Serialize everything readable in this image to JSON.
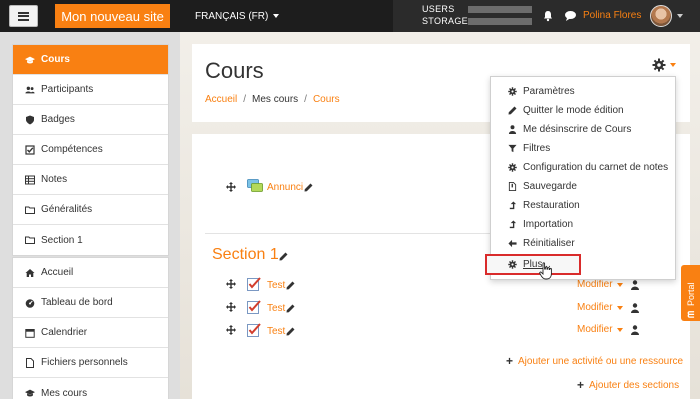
{
  "topbar": {
    "site_name": "Mon nouveau site",
    "language": "FRANÇAIS (FR)",
    "usage": {
      "users_label": "USERS",
      "storage_label": "STORAGE"
    },
    "user_name": "Polina Flores",
    "colors": {
      "bar": "#1d1d1d",
      "accent": "#f98012"
    }
  },
  "sidebar": {
    "course_items": [
      {
        "label": "Cours",
        "icon": "graduation-cap-icon",
        "active": true
      },
      {
        "label": "Participants",
        "icon": "users-icon"
      },
      {
        "label": "Badges",
        "icon": "shield-icon"
      },
      {
        "label": "Compétences",
        "icon": "checkbox-icon"
      },
      {
        "label": "Notes",
        "icon": "table-icon"
      },
      {
        "label": "Généralités",
        "icon": "folder-icon"
      },
      {
        "label": "Section 1",
        "icon": "folder-icon"
      }
    ],
    "site_items": [
      {
        "label": "Accueil",
        "icon": "home-icon"
      },
      {
        "label": "Tableau de bord",
        "icon": "dashboard-icon"
      },
      {
        "label": "Calendrier",
        "icon": "calendar-icon"
      },
      {
        "label": "Fichiers personnels",
        "icon": "file-icon"
      },
      {
        "label": "Mes cours",
        "icon": "graduation-cap-icon"
      }
    ]
  },
  "header": {
    "title": "Cours",
    "breadcrumb": [
      "Accueil",
      "/",
      "Mes cours",
      "/",
      "Cours"
    ]
  },
  "content": {
    "general_activity": "Annunci",
    "section_title": "Section 1",
    "quizzes": [
      {
        "label": "Test",
        "action": "Modifier"
      },
      {
        "label": "Test",
        "action": "Modifier"
      },
      {
        "label": "Test",
        "action": "Modifier"
      }
    ],
    "add_activity": "Ajouter une activité ou une ressource",
    "add_sections": "Ajouter des sections"
  },
  "dropdown": {
    "items": [
      {
        "label": "Paramètres",
        "icon": "gear-icon"
      },
      {
        "label": "Quitter le mode édition",
        "icon": "pencil-icon"
      },
      {
        "label": "Me désinscrire de Cours",
        "icon": "user-icon"
      },
      {
        "label": "Filtres",
        "icon": "filter-icon"
      },
      {
        "label": "Configuration du carnet de notes",
        "icon": "gear-icon"
      },
      {
        "label": "Sauvegarde",
        "icon": "file-archive-icon"
      },
      {
        "label": "Restauration",
        "icon": "level-up-icon"
      },
      {
        "label": "Importation",
        "icon": "level-up-icon"
      },
      {
        "label": "Réinitialiser",
        "icon": "arrow-left-icon"
      },
      {
        "label": "Plus...",
        "icon": "gear-icon",
        "highlighted": true
      }
    ]
  },
  "portal_tab": {
    "label": "Portal"
  }
}
